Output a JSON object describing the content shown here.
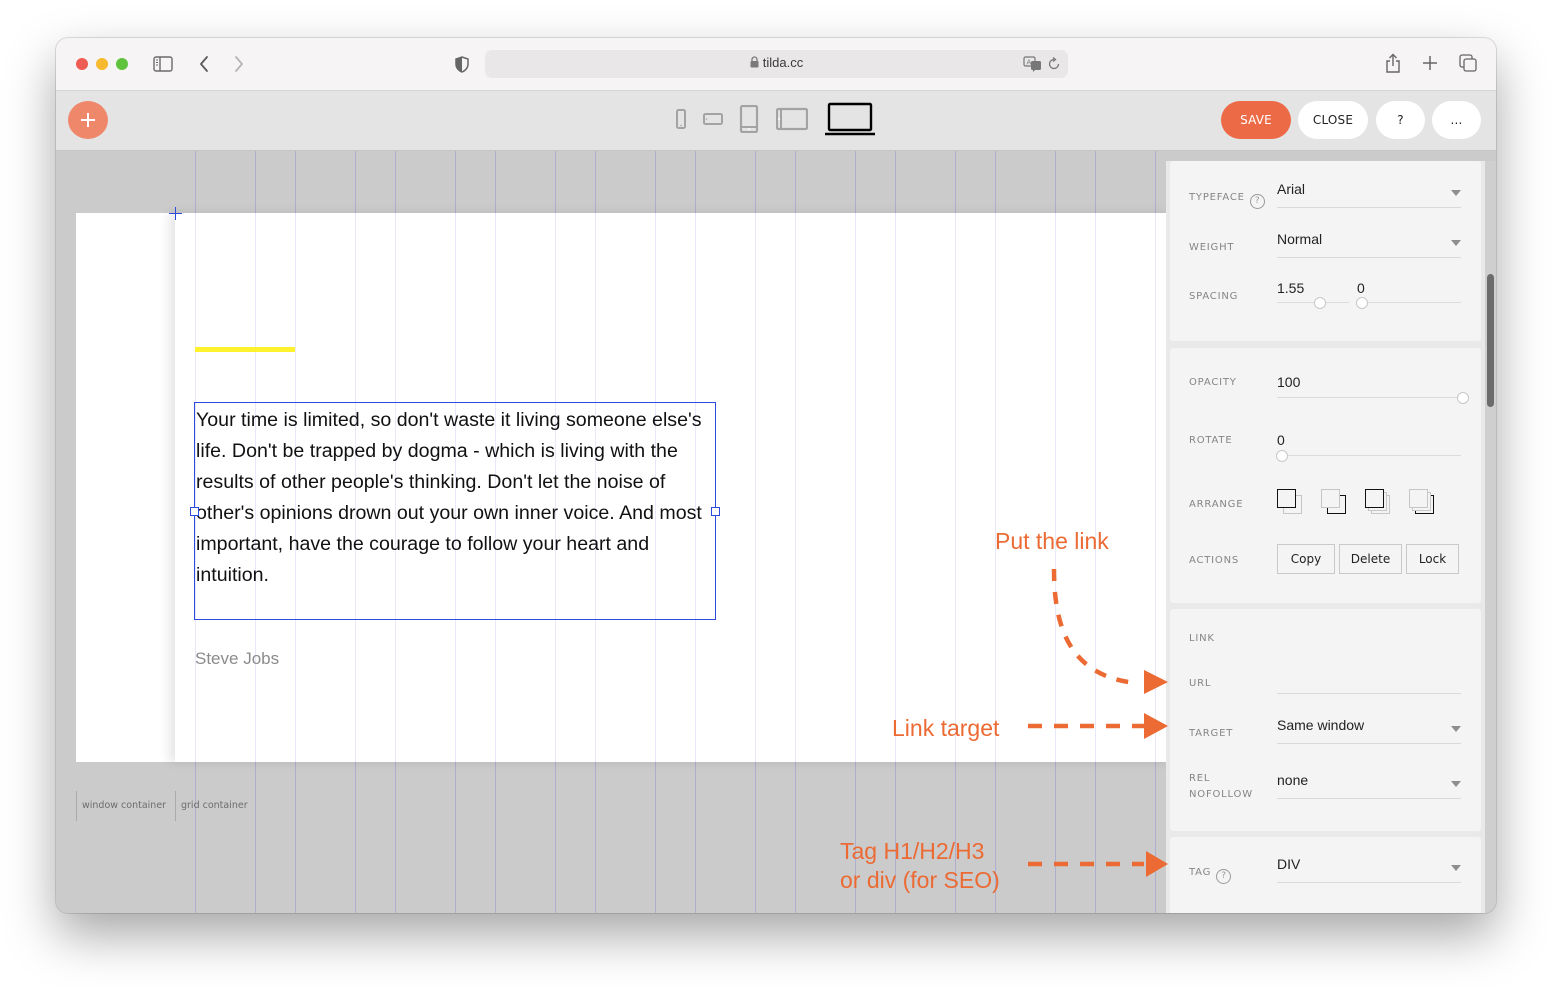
{
  "browser": {
    "url": "tilda.cc",
    "icons": [
      "sidebar-icon",
      "back-icon",
      "forward-icon",
      "privacy-shield-icon",
      "lock-icon",
      "translate-icon",
      "reload-icon",
      "share-icon",
      "new-tab-icon",
      "tabs-overview-icon"
    ]
  },
  "toolbar": {
    "add_label": "+",
    "devices": [
      "phone-portrait",
      "phone-landscape",
      "tablet-portrait",
      "tablet-landscape",
      "desktop"
    ],
    "active_device": "desktop",
    "save_label": "SAVE",
    "close_label": "CLOSE",
    "help_label": "?",
    "more_label": "..."
  },
  "canvas": {
    "quote": "Your time is limited, so don't waste it living someone else's life. Don't be trapped by dogma - which is living with the results of other people's thinking. Don't let the noise of other's opinions drown out your own inner voice. And most important, have the courage to follow your heart and intuition.",
    "author": "Steve Jobs",
    "labels": {
      "window_container": "window container",
      "grid_container": "grid container"
    },
    "accent_yellow": "#fff22c",
    "selection_color": "#2c4bdc"
  },
  "annotations": {
    "put_link": "Put the link",
    "link_target": "Link target",
    "tag_line1": "Tag H1/H2/H3",
    "tag_line2": "or div (for SEO)",
    "color": "#ec6a33"
  },
  "panel": {
    "typeface": {
      "label": "Typeface",
      "help": "?",
      "value": "Arial"
    },
    "weight": {
      "label": "Weight",
      "value": "Normal"
    },
    "spacing": {
      "label": "Spacing",
      "line_height": "1.55",
      "letter_spacing": "0"
    },
    "opacity": {
      "label": "Opacity",
      "value": "100"
    },
    "rotate": {
      "label": "Rotate",
      "value": "0"
    },
    "arrange": {
      "label": "Arrange",
      "icons": [
        "bring-to-front-icon",
        "send-to-back-icon",
        "bring-forward-icon",
        "send-backward-icon"
      ]
    },
    "actions": {
      "label": "Actions",
      "copy": "Copy",
      "delete": "Delete",
      "lock": "Lock"
    },
    "link": {
      "section_label": "Link",
      "url_label": "URL",
      "url_value": "",
      "target_label": "Target",
      "target_value": "Same window",
      "rel_label_1": "Rel",
      "rel_label_2": "Nofollow",
      "rel_value": "none"
    },
    "tag": {
      "label": "Tag",
      "help": "?",
      "value": "DIV"
    }
  }
}
